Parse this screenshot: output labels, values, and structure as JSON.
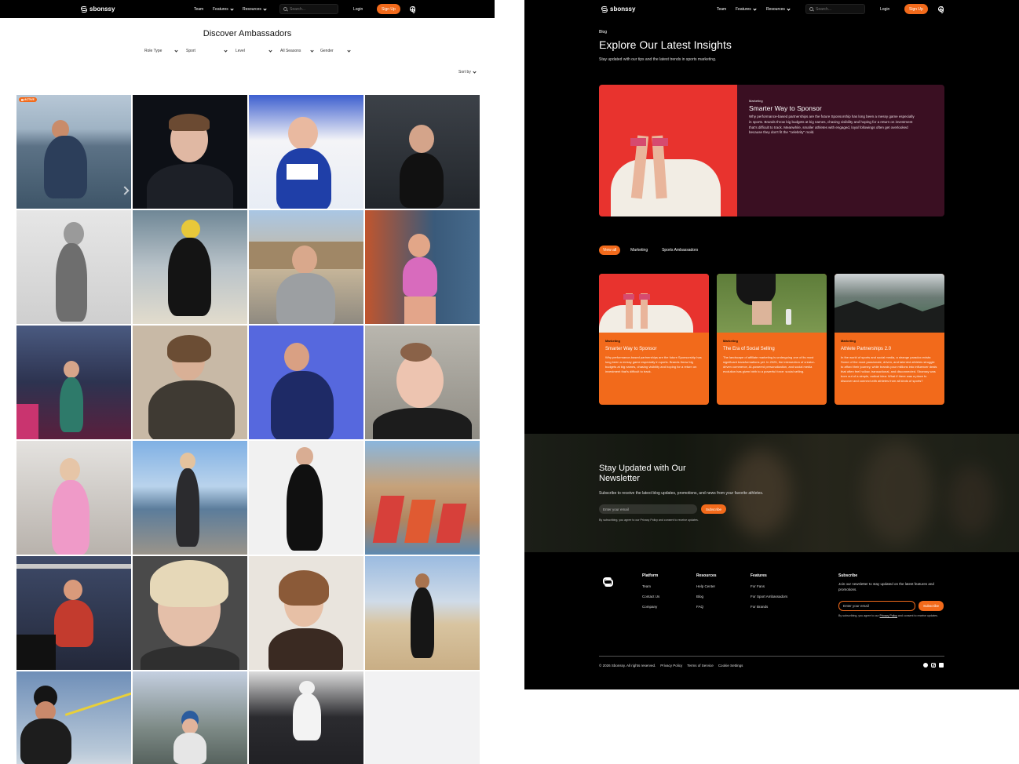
{
  "left": {
    "nav": {
      "brand": "sbonssy",
      "links": [
        "Team",
        "Features",
        "Resources"
      ],
      "search_placeholder": "Search...",
      "login": "Login",
      "signup": "Sign Up"
    },
    "page_title": "Discover Ambassadors",
    "filters": [
      "Role Type",
      "Sport",
      "Level",
      "All Seasons",
      "Gender"
    ],
    "sort_label": "Sort by",
    "active_badge": "ACTIVE"
  },
  "right": {
    "nav": {
      "brand": "sbonssy",
      "links": [
        "Team",
        "Features",
        "Resources"
      ],
      "search_placeholder": "Search...",
      "login": "Login",
      "signup": "Sign Up"
    },
    "blog_kicker": "Blog",
    "blog_title": "Explore Our Latest Insights",
    "blog_subtitle": "Stay updated with our tips and the latest trends in sports marketing.",
    "featured": {
      "tag": "Marketing",
      "title": "Smarter Way to Sponsor",
      "body": "Why performance-based partnerships are the future Sponsorship has long been a messy game especially in sports. Brands throw big budgets at big names, chasing visibility and hoping for a return on investment that's difficult to track. Meanwhile, smaller athletes with engaged, loyal followings often get overlooked because they don't fit the \"celebrity\" mold."
    },
    "tabs": [
      "View all",
      "Marketing",
      "Sports Ambassadors"
    ],
    "cards": [
      {
        "tag": "Marketing",
        "title": "Smarter Way to Sponsor",
        "text": "Why performance-based partnerships are the future Sponsorship has long been a messy game especially in sports. Brands throw big budgets at big names, chasing visibility and hoping for a return on investment that's difficult to track."
      },
      {
        "tag": "Marketing",
        "title": "The Era of Social Selling",
        "text": "The landscape of affiliate marketing is undergoing one of its most significant transformations yet. In 2025, the intersection of creator-driven commerce, AI-powered personalization, and social media evolution has given birth to a powerful force: social selling."
      },
      {
        "tag": "Marketing",
        "title": "Athlete Partnerships 2.0",
        "text": "In the world of sports and social media, a strange paradox exists: Some of the most passionate, driven, and talented athletes struggle to afford their journey, while brands pour millions into influencer deals that often feel hollow, transactional, and disconnected. Sbonssy was born out of a simple, radical idea: What if there was a place to discover and connect with athletes from all kinds of sports?"
      }
    ],
    "newsletter": {
      "title": "Stay Updated with Our Newsletter",
      "subtitle": "Subscribe to receive the latest blog updates, promotions, and news from your favorite athletes.",
      "placeholder": "Enter your email",
      "button": "Subscribe",
      "note": "By subscribing, you agree to our Privacy Policy and consent to receive updates."
    },
    "footer": {
      "columns": [
        {
          "heading": "Platform",
          "items": [
            "Team",
            "Contact Us",
            "Company"
          ]
        },
        {
          "heading": "Resources",
          "items": [
            "Help Center",
            "Blog",
            "FAQ"
          ]
        },
        {
          "heading": "Features",
          "items": [
            "For Fans",
            "For Sport Ambassadors",
            "For Brands"
          ]
        }
      ],
      "subscribe_heading": "Subscribe",
      "subscribe_text": "Join our newsletter to stay updated on the latest features and promotions.",
      "placeholder": "Enter your email",
      "button": "Subscribe",
      "note_prefix": "By subscribing, you agree to our ",
      "note_link": "Privacy Policy",
      "note_suffix": " and consent to receive updates.",
      "copyright": "© 2026 Sbonssy. All rights reserved.",
      "legal_links": [
        "Privacy Policy",
        "Terms of Service",
        "Cookie Settings"
      ]
    }
  },
  "colors": {
    "accent": "#f26a1b",
    "nav_bg": "#000000",
    "feature_bg": "#3a0f22"
  }
}
